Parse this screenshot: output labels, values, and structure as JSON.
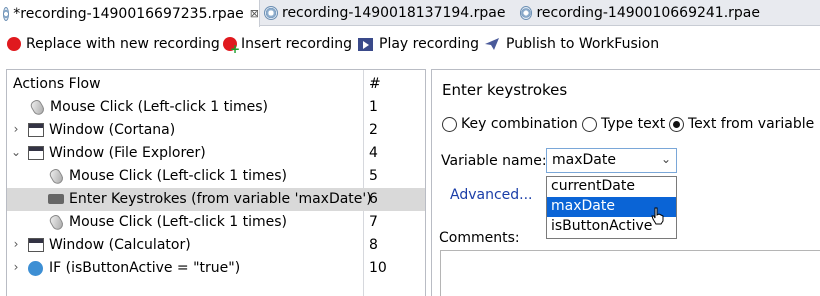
{
  "tabs": [
    {
      "label": "*recording-1490016697235.rpae",
      "close": "⊠"
    },
    {
      "label": "recording-1490018137194.rpae"
    },
    {
      "label": "recording-1490010669241.rpae"
    }
  ],
  "toolbar": {
    "replace": "Replace with new recording",
    "insert": "Insert recording",
    "play": "Play recording",
    "publish": "Publish to WorkFusion"
  },
  "actions": {
    "header_label": "Actions Flow",
    "header_num": "#",
    "rows": [
      {
        "label": "Mouse Click (Left-click 1 times)",
        "num": "1",
        "icon": "mouse-icon"
      },
      {
        "label": "Window (Cortana)",
        "num": "2",
        "icon": "window-icon",
        "expander": "›"
      },
      {
        "label": "Window (File Explorer)",
        "num": "4",
        "icon": "window-icon",
        "expander": "⌄"
      },
      {
        "label": "Mouse Click (Left-click 1 times)",
        "num": "5",
        "icon": "mouse-icon"
      },
      {
        "label": "Enter Keystrokes (from variable 'maxDate')",
        "num": "6",
        "icon": "keyboard-icon",
        "selected": true
      },
      {
        "label": "Mouse Click (Left-click 1 times)",
        "num": "7",
        "icon": "mouse-icon"
      },
      {
        "label": "Window (Calculator)",
        "num": "8",
        "icon": "window-icon",
        "expander": "›"
      },
      {
        "label": "IF (isButtonActive = \"true\")",
        "num": "10",
        "icon": "if-icon",
        "expander": "›"
      }
    ]
  },
  "detail": {
    "title": "Enter keystrokes",
    "radio_key_combination": "Key combination",
    "radio_type_text": "Type text",
    "radio_text_from_variable": "Text from variable",
    "selected_radio": "Text from variable",
    "variable_label": "Variable name:",
    "variable_value": "maxDate",
    "advanced": "Advanced...",
    "options": [
      "currentDate",
      "maxDate",
      "isButtonActive"
    ],
    "highlighted_option": "maxDate",
    "comments_label": "Comments:"
  }
}
